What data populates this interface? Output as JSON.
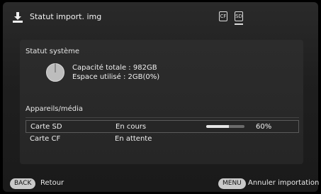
{
  "header": {
    "title": "Statut import. img",
    "icon": "usb-import-icon",
    "media_icons": [
      {
        "name": "cf-card-icon",
        "label": "CF"
      },
      {
        "name": "sd-card-icon",
        "label": "SD"
      }
    ]
  },
  "system": {
    "title": "Statut système",
    "capacity_line": "Capacité totale : 982GB",
    "used_line": "Espace utilisé : 2GB(0%)"
  },
  "devices": {
    "title": "Appareils/média",
    "rows": [
      {
        "name": "Carte SD",
        "status": "En cours",
        "progress": 0.6,
        "percent": "60%"
      },
      {
        "name": "Carte CF",
        "status": "En attente"
      }
    ]
  },
  "footer": {
    "back_key": "BACK",
    "back_label": "Retour",
    "menu_key": "MENU",
    "menu_label": "Annuler importation"
  },
  "colors": {
    "background": "#1f1f1f",
    "panel": "#2a2a2a",
    "text": "#f0f0f0",
    "button": "#c9c9c9",
    "progress_fill": "#e6e6e6",
    "progress_track": "#6b6b6b"
  }
}
